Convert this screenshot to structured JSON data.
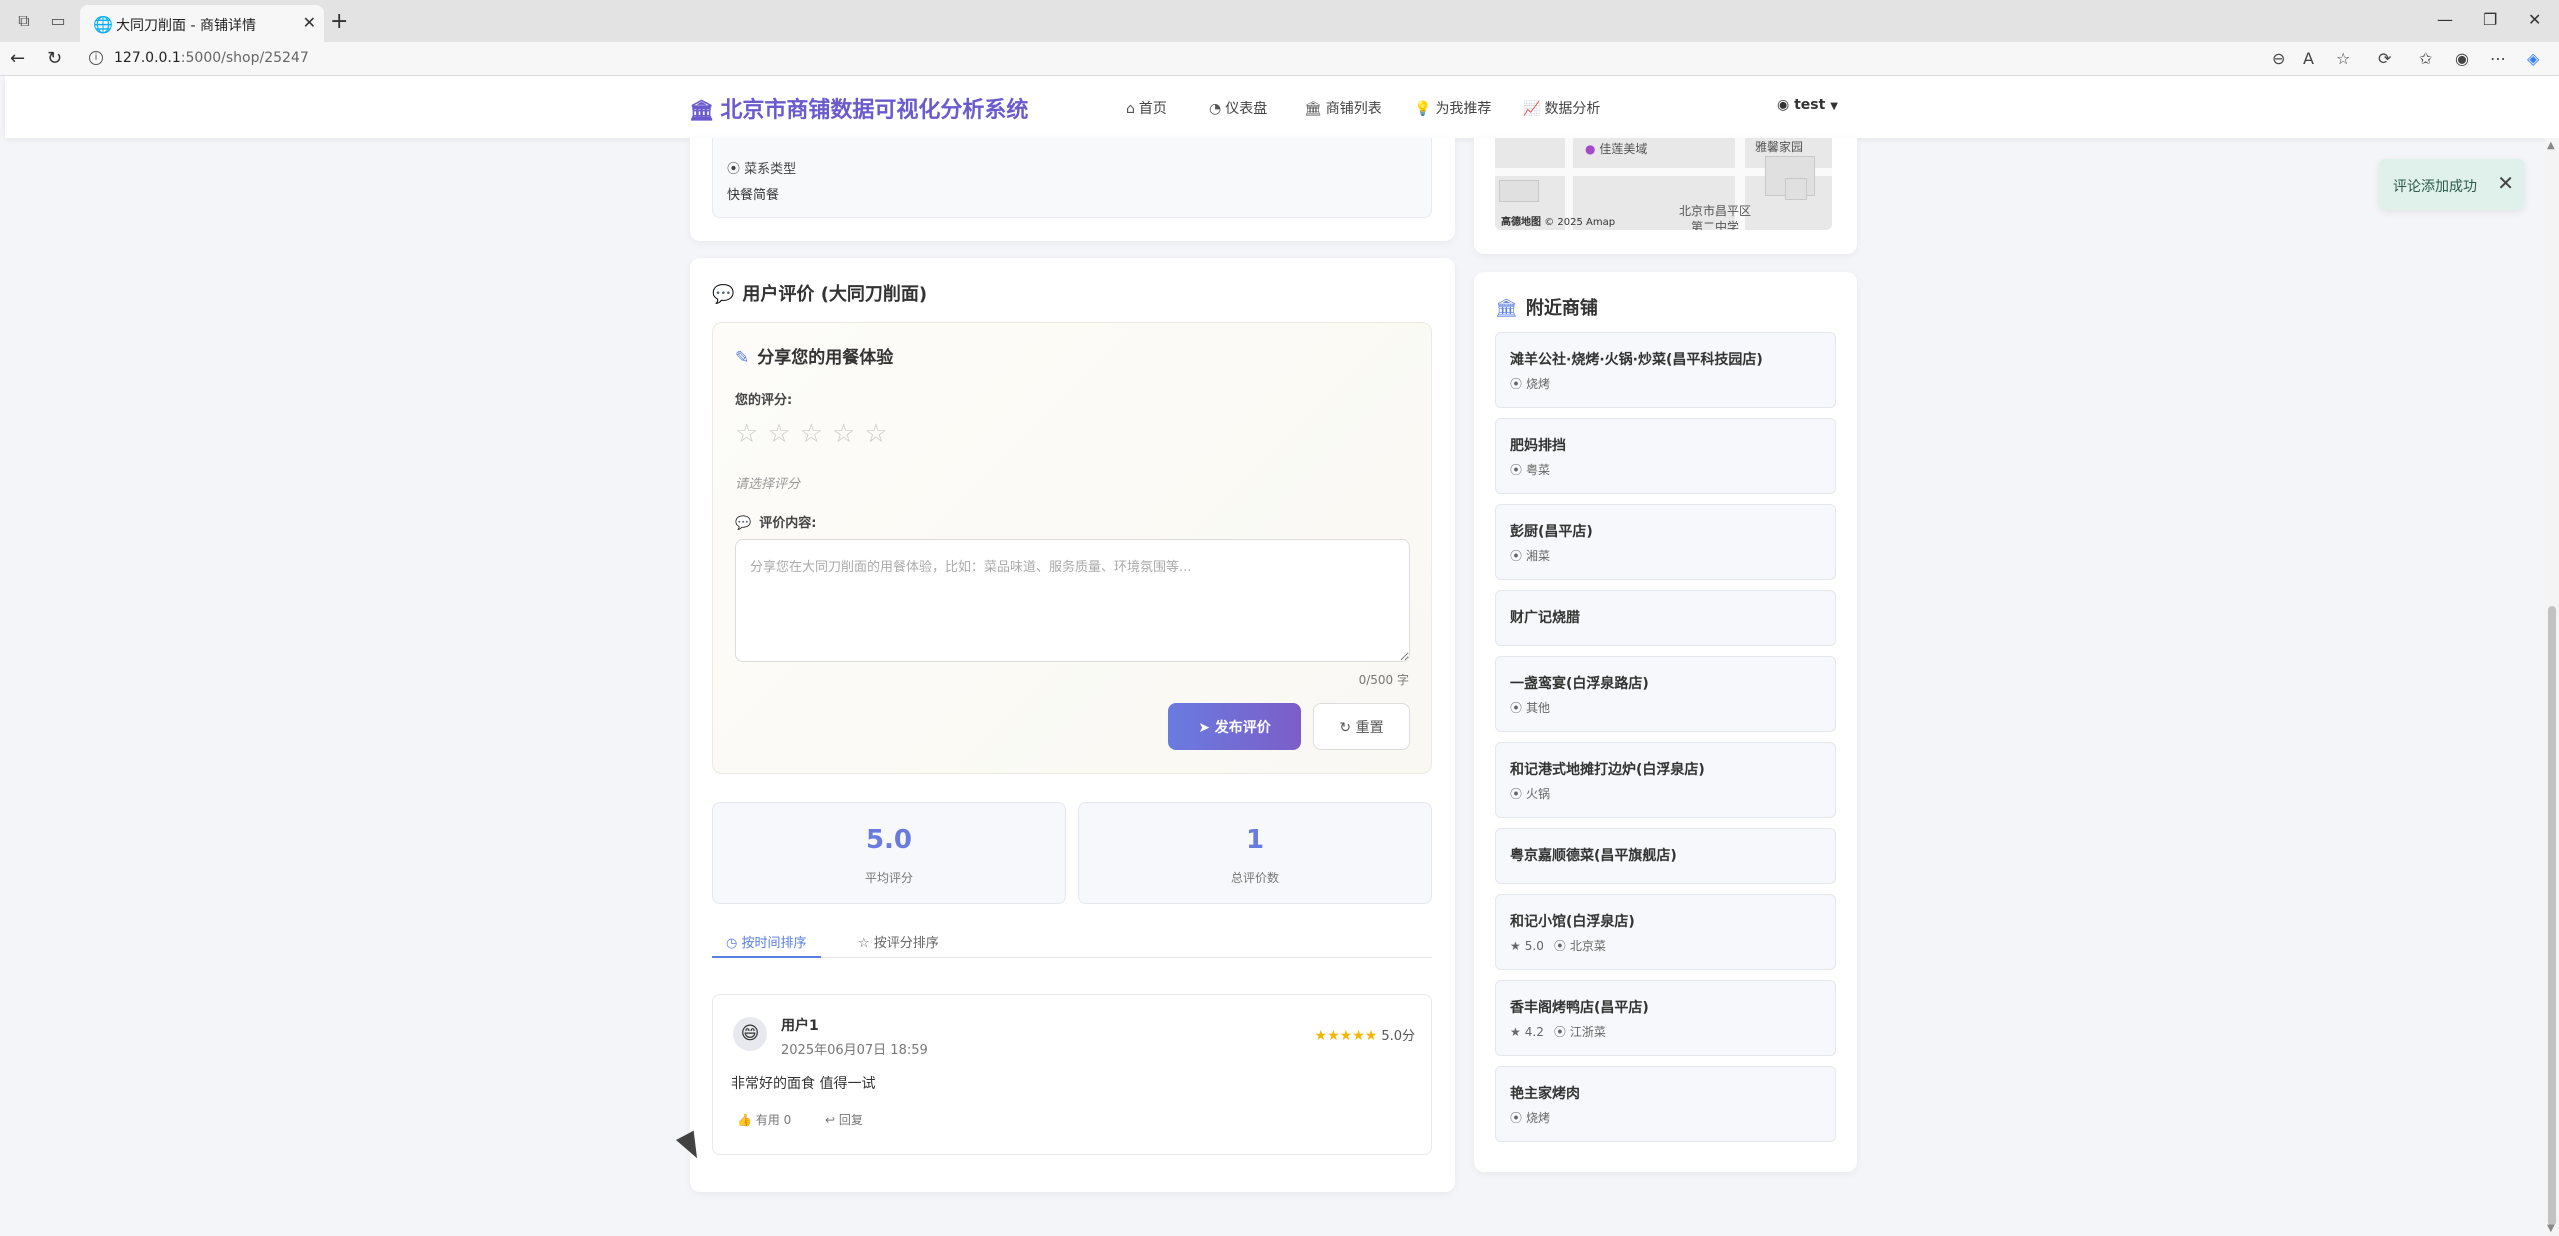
{
  "browser": {
    "tab_title": "大同刀削面 - 商铺详情",
    "url_host": "127.0.0.1",
    "url_path": ":5000/shop/25247"
  },
  "nav": {
    "brand": "北京市商铺数据可视化分析系统",
    "items": [
      {
        "label": "首页",
        "icon": "home-icon"
      },
      {
        "label": "仪表盘",
        "icon": "dashboard-icon"
      },
      {
        "label": "商铺列表",
        "icon": "shop-icon"
      },
      {
        "label": "为我推荐",
        "icon": "lightbulb-icon"
      },
      {
        "label": "数据分析",
        "icon": "chart-icon"
      }
    ],
    "user": "test"
  },
  "info": {
    "cuisine_label": "菜系类型",
    "cuisine_value": "快餐简餐"
  },
  "map": {
    "labels": [
      "佳莲美域",
      "雅馨家园",
      "北京市昌平区",
      "第二中学"
    ],
    "logo": "高德地图",
    "copyright": "© 2025 Amap"
  },
  "reviews": {
    "title": "用户评价 (大同刀削面)",
    "form": {
      "title": "分享您的用餐体验",
      "rating_label": "您的评分:",
      "rating_hint": "请选择评分",
      "content_label": "评价内容:",
      "placeholder": "分享您在大同刀削面的用餐体验，比如：菜品味道、服务质量、环境氛围等...",
      "counter": "0/500 字",
      "submit": "发布评价",
      "reset": "重置"
    },
    "stats": {
      "avg_score": "5.0",
      "avg_label": "平均评分",
      "total": "1",
      "total_label": "总评价数"
    },
    "sort": {
      "by_time": "按时间排序",
      "by_rating": "按评分排序"
    },
    "items": [
      {
        "user": "用户1",
        "time": "2025年06月07日 18:59",
        "stars": "★★★★★",
        "score": "5.0分",
        "text": "非常好的面食 值得一试",
        "helpful": "有用 0",
        "reply": "回复"
      }
    ]
  },
  "nearby": {
    "title": "附近商铺",
    "shops": [
      {
        "name": "滩羊公社·烧烤·火锅·炒菜(昌平科技园店)",
        "rating": "",
        "cuisine": "烧烤"
      },
      {
        "name": "肥妈排挡",
        "rating": "",
        "cuisine": "粤菜"
      },
      {
        "name": "彭厨(昌平店)",
        "rating": "",
        "cuisine": "湘菜"
      },
      {
        "name": "财广记烧腊",
        "rating": "",
        "cuisine": ""
      },
      {
        "name": "一盏鸾宴(白浮泉路店)",
        "rating": "",
        "cuisine": "其他"
      },
      {
        "name": "和记港式地摊打边炉(白浮泉店)",
        "rating": "",
        "cuisine": "火锅"
      },
      {
        "name": "粤京嘉顺德菜(昌平旗舰店)",
        "rating": "",
        "cuisine": ""
      },
      {
        "name": "和记小馆(白浮泉店)",
        "rating": "5.0",
        "cuisine": "北京菜"
      },
      {
        "name": "香丰阁烤鸭店(昌平店)",
        "rating": "4.2",
        "cuisine": "江浙菜"
      },
      {
        "name": "艳主家烤肉",
        "rating": "",
        "cuisine": "烧烤"
      }
    ]
  },
  "toast": {
    "message": "评论添加成功"
  }
}
